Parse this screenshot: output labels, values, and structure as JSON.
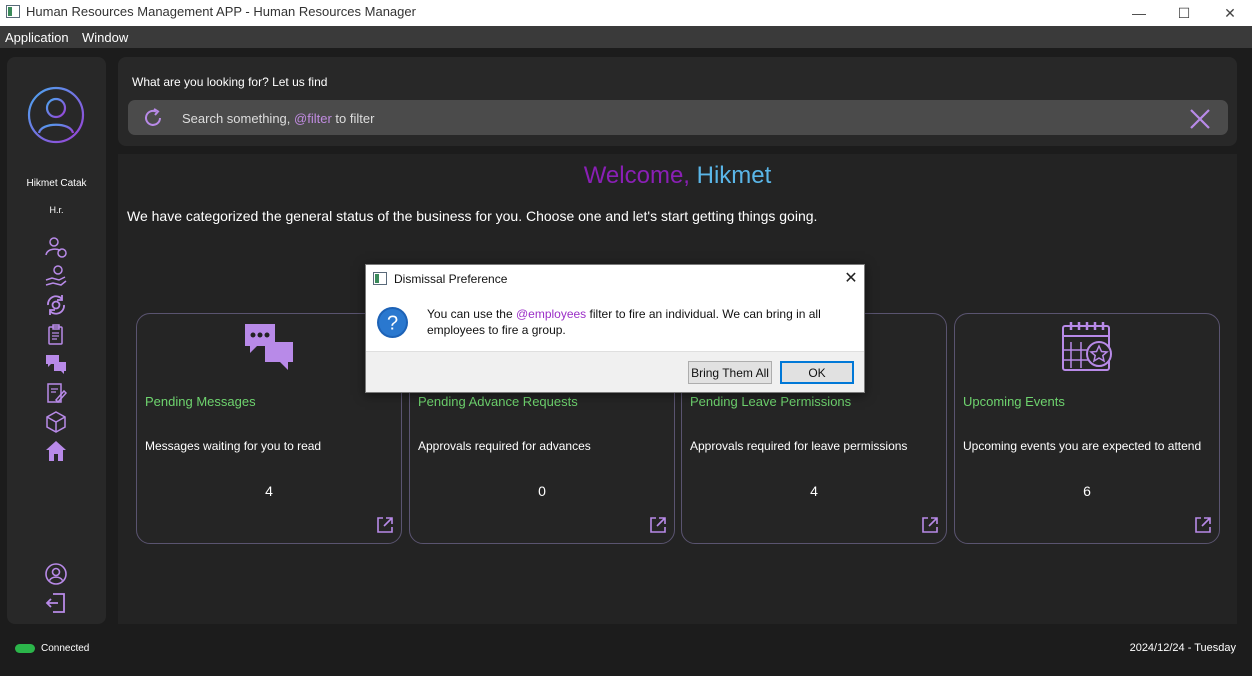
{
  "window": {
    "title": "Human Resources Management APP - Human Resources Manager",
    "minimize_glyph": "—",
    "maximize_glyph": "☐",
    "close_glyph": "✕"
  },
  "menubar": {
    "items": [
      "Application",
      "Window"
    ]
  },
  "sidebar": {
    "user_name": "Hikmet Catak",
    "user_role": "H.r.",
    "accent_color": "#b88ae8",
    "nav_icons": [
      "user-settings-icon",
      "hand-coin-icon",
      "refresh-gear-icon",
      "clipboard-icon",
      "chat-bubbles-icon",
      "edit-document-icon",
      "package-icon",
      "home-icon"
    ],
    "bottom_icons": [
      "profile-icon",
      "logout-icon"
    ]
  },
  "search": {
    "caption": "What are you looking for? Let us find",
    "placeholder_prefix": "Search something, ",
    "placeholder_filter": "@filter",
    "placeholder_suffix": " to filter"
  },
  "main": {
    "welcome_prefix": "Welcome, ",
    "welcome_name": "Hikmet",
    "subtitle": "We have categorized the general status of the business for you. Choose one and let's start getting things going."
  },
  "cards": [
    {
      "icon": "chat-bubbles-icon",
      "title": "Pending Messages",
      "description": "Messages waiting for you to read",
      "count": "4"
    },
    {
      "icon": "hand-coin-icon",
      "title": "Pending Advance Requests",
      "description": "Approvals required for advances",
      "count": "0"
    },
    {
      "icon": "leave-icon",
      "title": "Pending Leave Permissions",
      "description": "Approvals required for leave permissions",
      "count": "4"
    },
    {
      "icon": "calendar-star-icon",
      "title": "Upcoming Events",
      "description": "Upcoming events you are expected to attend",
      "count": "6"
    }
  ],
  "status": {
    "connection": "Connected",
    "connection_color": "#2bb54a",
    "date": "2024/12/24 - Tuesday"
  },
  "dialog": {
    "title": "Dismissal Preference",
    "close_glyph": "✕",
    "message_prefix": "You can use the ",
    "message_filter": "@employees",
    "message_suffix": " filter to fire an individual. We can bring in all employees to fire a group.",
    "bring_all_label": "Bring Them All",
    "ok_label": "OK"
  }
}
